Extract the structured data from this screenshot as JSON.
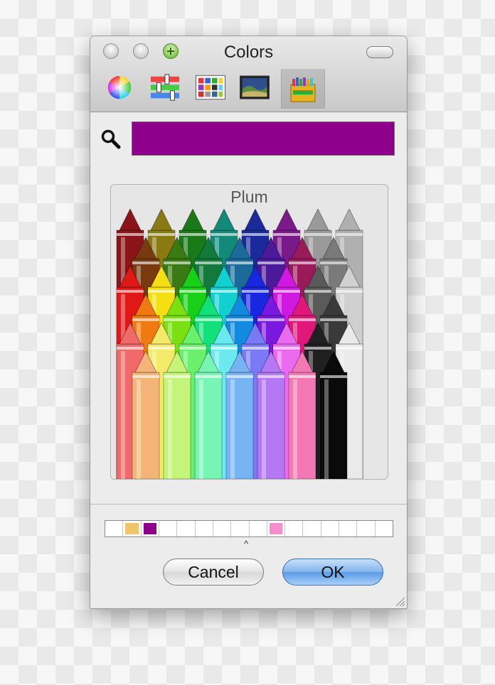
{
  "window": {
    "title": "Colors"
  },
  "toolbar": {
    "modes": [
      {
        "name": "color-wheel"
      },
      {
        "name": "color-sliders"
      },
      {
        "name": "color-palettes"
      },
      {
        "name": "image-palettes"
      },
      {
        "name": "crayons",
        "selected": true
      }
    ]
  },
  "current_color": "#8e008b",
  "crayon_box": {
    "selected_name": "Plum"
  },
  "favorite_swatches": [
    "",
    "#f2c36b",
    "#8e008b",
    "",
    "",
    "",
    "",
    "",
    "",
    "#f48fcb",
    "",
    "",
    "",
    "",
    "",
    ""
  ],
  "buttons": {
    "cancel": "Cancel",
    "ok": "OK"
  }
}
